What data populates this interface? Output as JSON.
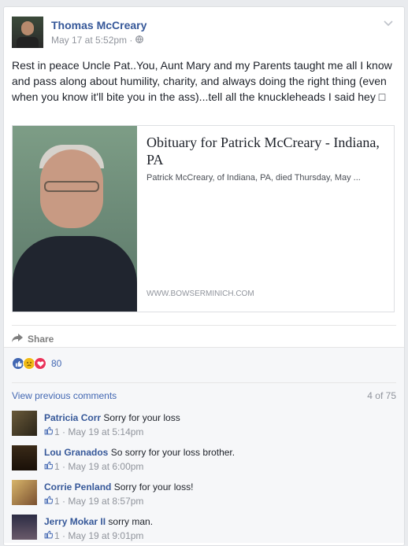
{
  "post": {
    "author": "Thomas McCreary",
    "timestamp": "May 17 at 5:52pm",
    "separator": "·",
    "audience_icon": "globe-icon",
    "menu_icon": "chevron-down-icon",
    "text": "Rest in peace Uncle Pat..You, Aunt Mary and my Parents taught me all I know and pass along about humility, charity, and always doing the right thing (even when you know it'll bite you in the ass)...tell all the knuckleheads I said hey □",
    "link": {
      "title": "Obituary for Patrick McCreary - Indiana, PA",
      "description": "Patrick McCreary, of Indiana, PA, died Thursday, May ...",
      "domain": "WWW.BOWSERMINICH.COM"
    },
    "actions": {
      "share_label": "Share"
    }
  },
  "reactions": {
    "count": "80",
    "types": [
      "like",
      "sad",
      "love"
    ]
  },
  "comments": {
    "view_previous": "View previous comments",
    "count_label": "4 of 75",
    "items": [
      {
        "name": "Patricia Corr",
        "text": "Sorry for your loss",
        "likes": "1",
        "time": "May 19 at 5:14pm"
      },
      {
        "name": "Lou Granados",
        "text": "So sorry for your loss brother.",
        "likes": "1",
        "time": "May 19 at 6:00pm"
      },
      {
        "name": "Corrie Penland",
        "text": "Sorry for your loss!",
        "likes": "1",
        "time": "May 19 at 8:57pm"
      },
      {
        "name": "Jerry Mokar II",
        "text": "sorry man.",
        "likes": "1",
        "time": "May 19 at 9:01pm"
      }
    ]
  },
  "colors": {
    "link_blue": "#365899",
    "meta_gray": "#90949c",
    "like_blue": "#4267b2"
  }
}
